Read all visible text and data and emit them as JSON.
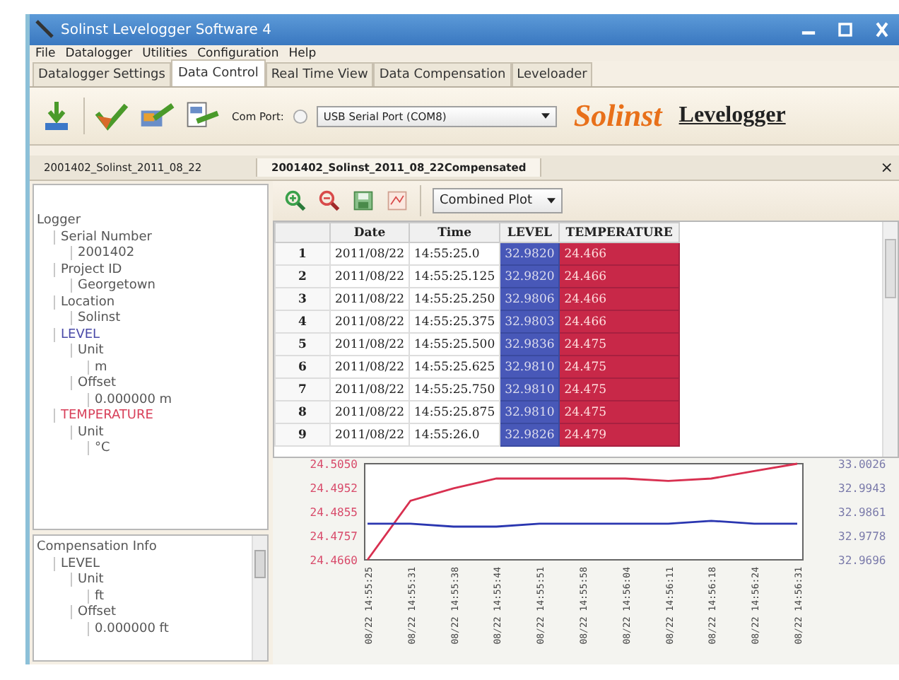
{
  "window": {
    "title": "Solinst Levelogger Software 4"
  },
  "menu": [
    "File",
    "Datalogger",
    "Utilities",
    "Configuration",
    "Help"
  ],
  "tabs": [
    {
      "label": "Datalogger Settings",
      "selected": false
    },
    {
      "label": "Data Control",
      "selected": true
    },
    {
      "label": "Real Time View",
      "selected": false
    },
    {
      "label": "Data Compensation",
      "selected": false
    },
    {
      "label": "Leveloader",
      "selected": false
    }
  ],
  "toolbar": {
    "com_port_label": "Com Port:",
    "com_port": "USB Serial Port (COM8)",
    "logo_brand": "Solinst",
    "logo_product": "Levelogger"
  },
  "documents": [
    {
      "label": "2001402_Solinst_2011_08_22",
      "selected": false
    },
    {
      "label": "2001402_Solinst_2011_08_22Compensated",
      "selected": true
    }
  ],
  "document_close": "×",
  "logger_tree": [
    {
      "label": "Logger",
      "children": [
        {
          "label": "Serial Number",
          "children": [
            {
              "label": "2001402"
            }
          ]
        },
        {
          "label": "Project ID",
          "children": [
            {
              "label": "Georgetown"
            }
          ]
        },
        {
          "label": "Location",
          "children": [
            {
              "label": "Solinst"
            }
          ]
        },
        {
          "label": "LEVEL",
          "color": "#4a4aa8",
          "children": [
            {
              "label": "Unit",
              "children": [
                {
                  "label": "m"
                }
              ]
            },
            {
              "label": "Offset",
              "children": [
                {
                  "label": "0.000000 m"
                }
              ]
            }
          ]
        },
        {
          "label": "TEMPERATURE",
          "color": "#d8405a",
          "children": [
            {
              "label": "Unit",
              "children": [
                {
                  "label": "°C"
                }
              ]
            }
          ]
        }
      ]
    }
  ],
  "compensation_tree": [
    {
      "label": "Compensation Info",
      "children": [
        {
          "label": "LEVEL",
          "children": [
            {
              "label": "Unit",
              "children": [
                {
                  "label": "ft"
                }
              ]
            },
            {
              "label": "Offset",
              "children": [
                {
                  "label": "0.000000 ft"
                }
              ]
            }
          ]
        }
      ]
    }
  ],
  "plot_toolbar": {
    "view": "Combined Plot"
  },
  "table": {
    "columns": [
      "",
      "Date",
      "Time",
      "LEVEL",
      "TEMPERATURE"
    ],
    "rows": [
      [
        "1",
        "2011/08/22",
        "14:55:25.0",
        "32.9820",
        "24.466"
      ],
      [
        "2",
        "2011/08/22",
        "14:55:25.125",
        "32.9820",
        "24.466"
      ],
      [
        "3",
        "2011/08/22",
        "14:55:25.250",
        "32.9806",
        "24.466"
      ],
      [
        "4",
        "2011/08/22",
        "14:55:25.375",
        "32.9803",
        "24.466"
      ],
      [
        "5",
        "2011/08/22",
        "14:55:25.500",
        "32.9836",
        "24.475"
      ],
      [
        "6",
        "2011/08/22",
        "14:55:25.625",
        "32.9810",
        "24.475"
      ],
      [
        "7",
        "2011/08/22",
        "14:55:25.750",
        "32.9810",
        "24.475"
      ],
      [
        "8",
        "2011/08/22",
        "14:55:25.875",
        "32.9810",
        "24.475"
      ],
      [
        "9",
        "2011/08/22",
        "14:55:26.0",
        "32.9826",
        "24.479"
      ]
    ]
  },
  "chart_data": {
    "type": "line",
    "categories": [
      "08/22 14:55:25",
      "08/22 14:55:31",
      "08/22 14:55:38",
      "08/22 14:55:44",
      "08/22 14:55:51",
      "08/22 14:55:58",
      "08/22 14:56:04",
      "08/22 14:56:11",
      "08/22 14:56:18",
      "08/22 14:56:24",
      "08/22 14:56:31"
    ],
    "series": [
      {
        "color": "#d83050",
        "values": [
          24.466,
          24.49,
          24.495,
          24.499,
          24.499,
          24.499,
          24.499,
          24.498,
          24.499,
          24.502,
          24.505
        ]
      },
      {
        "color": "#2a36b0",
        "axis": "y2",
        "values": [
          32.982,
          32.982,
          32.981,
          32.981,
          32.982,
          32.982,
          32.982,
          32.982,
          32.983,
          32.982,
          32.982
        ]
      }
    ],
    "ylim": [
      24.466,
      24.505
    ],
    "yticks": [
      {
        "value": 24.505,
        "label": "24.5050"
      },
      {
        "value": 24.4952,
        "label": "24.4952"
      },
      {
        "value": 24.4855,
        "label": "24.4855"
      },
      {
        "value": 24.4757,
        "label": "24.4757"
      },
      {
        "value": 24.466,
        "label": "24.4660"
      }
    ],
    "y2lim": [
      32.9696,
      33.0026
    ],
    "y2ticks": [
      {
        "value": 33.0026,
        "label": "33.0026"
      },
      {
        "value": 32.9943,
        "label": "32.9943"
      },
      {
        "value": 32.9861,
        "label": "32.9861"
      },
      {
        "value": 32.9778,
        "label": "32.9778"
      },
      {
        "value": 32.9696,
        "label": "32.9696"
      }
    ]
  }
}
